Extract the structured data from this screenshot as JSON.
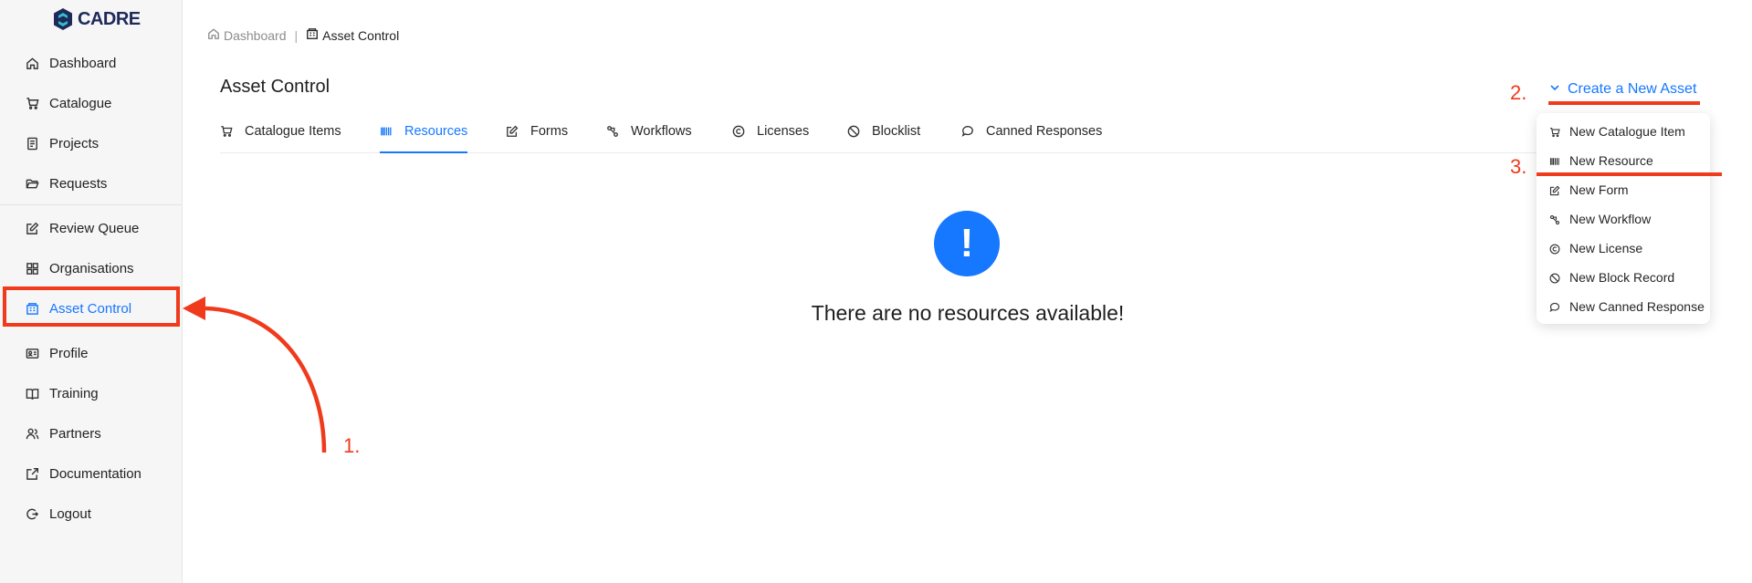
{
  "app": {
    "logo_text": "CADRE"
  },
  "sidebar": {
    "items": [
      {
        "label": "Dashboard",
        "icon": "home-icon"
      },
      {
        "label": "Catalogue",
        "icon": "cart-icon"
      },
      {
        "label": "Projects",
        "icon": "document-icon"
      },
      {
        "label": "Requests",
        "icon": "folder-open-icon"
      },
      {
        "label": "Review Queue",
        "icon": "edit-icon"
      },
      {
        "label": "Organisations",
        "icon": "grid-icon"
      },
      {
        "label": "Asset Control",
        "icon": "asset-control-icon",
        "active": true
      },
      {
        "label": "Profile",
        "icon": "id-card-icon"
      },
      {
        "label": "Training",
        "icon": "book-icon"
      },
      {
        "label": "Partners",
        "icon": "users-icon"
      },
      {
        "label": "Documentation",
        "icon": "external-link-icon"
      },
      {
        "label": "Logout",
        "icon": "logout-icon"
      }
    ]
  },
  "breadcrumb": {
    "items": [
      {
        "label": "Dashboard",
        "icon": "home-icon"
      },
      {
        "label": "Asset Control",
        "icon": "asset-control-icon"
      }
    ],
    "separator": "|"
  },
  "page": {
    "title": "Asset Control"
  },
  "tabs": [
    {
      "label": "Catalogue Items",
      "icon": "cart-icon"
    },
    {
      "label": "Resources",
      "icon": "barcode-icon",
      "active": true
    },
    {
      "label": "Forms",
      "icon": "edit-icon"
    },
    {
      "label": "Workflows",
      "icon": "workflow-icon"
    },
    {
      "label": "Licenses",
      "icon": "copyright-icon"
    },
    {
      "label": "Blocklist",
      "icon": "block-icon"
    },
    {
      "label": "Canned Responses",
      "icon": "chat-icon"
    }
  ],
  "empty_state": {
    "icon_glyph": "!",
    "message": "There are no resources available!"
  },
  "create_menu": {
    "button_label": "Create a New Asset",
    "items": [
      {
        "label": "New Catalogue Item",
        "icon": "cart-icon"
      },
      {
        "label": "New Resource",
        "icon": "barcode-icon"
      },
      {
        "label": "New Form",
        "icon": "edit-icon"
      },
      {
        "label": "New Workflow",
        "icon": "workflow-icon"
      },
      {
        "label": "New License",
        "icon": "copyright-icon"
      },
      {
        "label": "New Block Record",
        "icon": "block-icon"
      },
      {
        "label": "New Canned Response",
        "icon": "chat-icon"
      }
    ]
  },
  "annotations": {
    "step1": "1.",
    "step2": "2.",
    "step3": "3.",
    "color": "#f03a1c"
  },
  "colors": {
    "accent": "#1677ff",
    "sidebar_bg": "#f6f6f7",
    "annotation": "#f03a1c"
  }
}
